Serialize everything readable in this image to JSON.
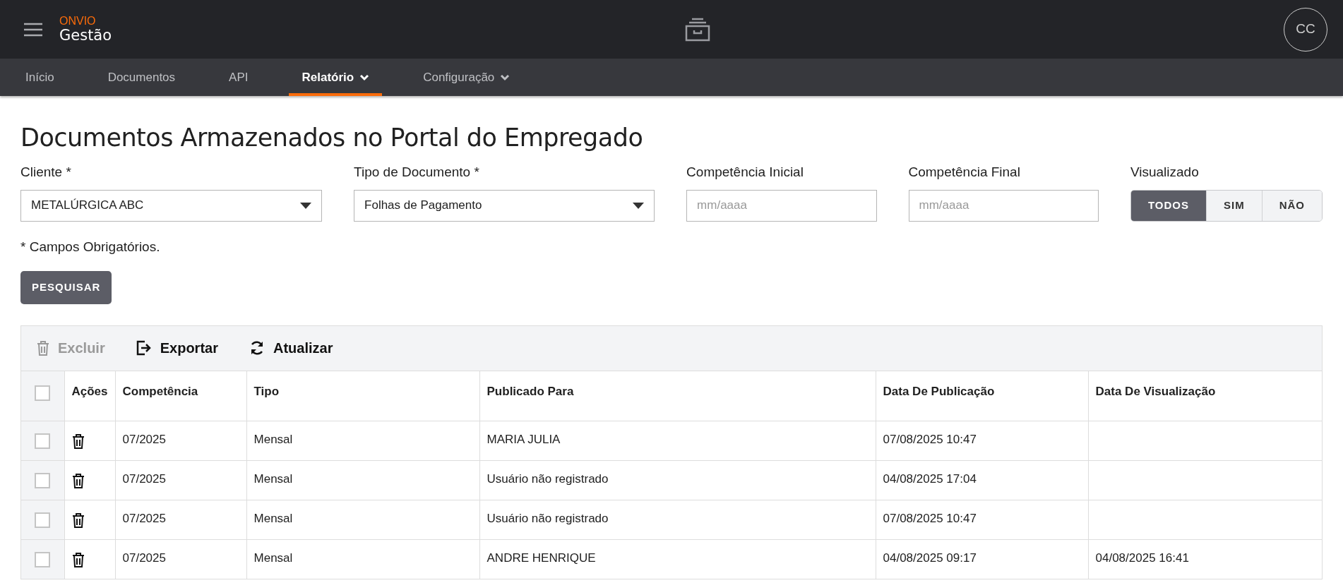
{
  "header": {
    "brand": "ONVIO",
    "product": "Gestão",
    "avatar": "CC"
  },
  "nav": [
    {
      "label": "Início",
      "selected": false,
      "has_menu": false
    },
    {
      "label": "Documentos",
      "selected": false,
      "has_menu": false
    },
    {
      "label": "API",
      "selected": false,
      "has_menu": false
    },
    {
      "label": "Relatório",
      "selected": true,
      "has_menu": true
    },
    {
      "label": "Configuração",
      "selected": false,
      "has_menu": true
    }
  ],
  "page_title": "Documentos Armazenados no Portal do Empregado",
  "filters": [
    {
      "kind": "select",
      "label": "Cliente *",
      "value": "METALÚRGICA ABC"
    },
    {
      "kind": "select",
      "label": "Tipo de Documento *",
      "value": "Folhas de Pagamento"
    },
    {
      "kind": "text",
      "label": "Competência Inicial",
      "placeholder": "mm/aaaa"
    },
    {
      "kind": "text",
      "label": "Competência Final",
      "placeholder": "mm/aaaa"
    }
  ],
  "visualizado": {
    "label": "Visualizado",
    "options": [
      {
        "label": "TODOS",
        "selected": true
      },
      {
        "label": "SIM",
        "selected": false
      },
      {
        "label": "NÃO",
        "selected": false
      }
    ]
  },
  "required_note": "* Campos Obrigatórios.",
  "search_button": "PESQUISAR",
  "toolbar": [
    {
      "kind": "delete",
      "label": "Excluir",
      "disabled": true
    },
    {
      "kind": "export",
      "label": "Exportar",
      "disabled": false
    },
    {
      "kind": "refresh",
      "label": "Atualizar",
      "disabled": false
    }
  ],
  "table": {
    "select_all_checked": false,
    "columns": [
      "Ações",
      "Competência",
      "Tipo",
      "Publicado Para",
      "Data De Publicação",
      "Data De Visualização"
    ],
    "rows": [
      {
        "checked": false,
        "competencia": "07/2025",
        "tipo": "Mensal",
        "publicado_para": "MARIA JULIA",
        "data_publicacao": "07/08/2025 10:47",
        "data_visualizacao": ""
      },
      {
        "checked": false,
        "competencia": "07/2025",
        "tipo": "Mensal",
        "publicado_para": "Usuário não registrado",
        "data_publicacao": "04/08/2025 17:04",
        "data_visualizacao": ""
      },
      {
        "checked": false,
        "competencia": "07/2025",
        "tipo": "Mensal",
        "publicado_para": "Usuário não registrado",
        "data_publicacao": "07/08/2025 10:47",
        "data_visualizacao": ""
      },
      {
        "checked": false,
        "competencia": "07/2025",
        "tipo": "Mensal",
        "publicado_para": "ANDRE HENRIQUE",
        "data_publicacao": "04/08/2025 09:17",
        "data_visualizacao": "04/08/2025 16:41"
      }
    ]
  }
}
